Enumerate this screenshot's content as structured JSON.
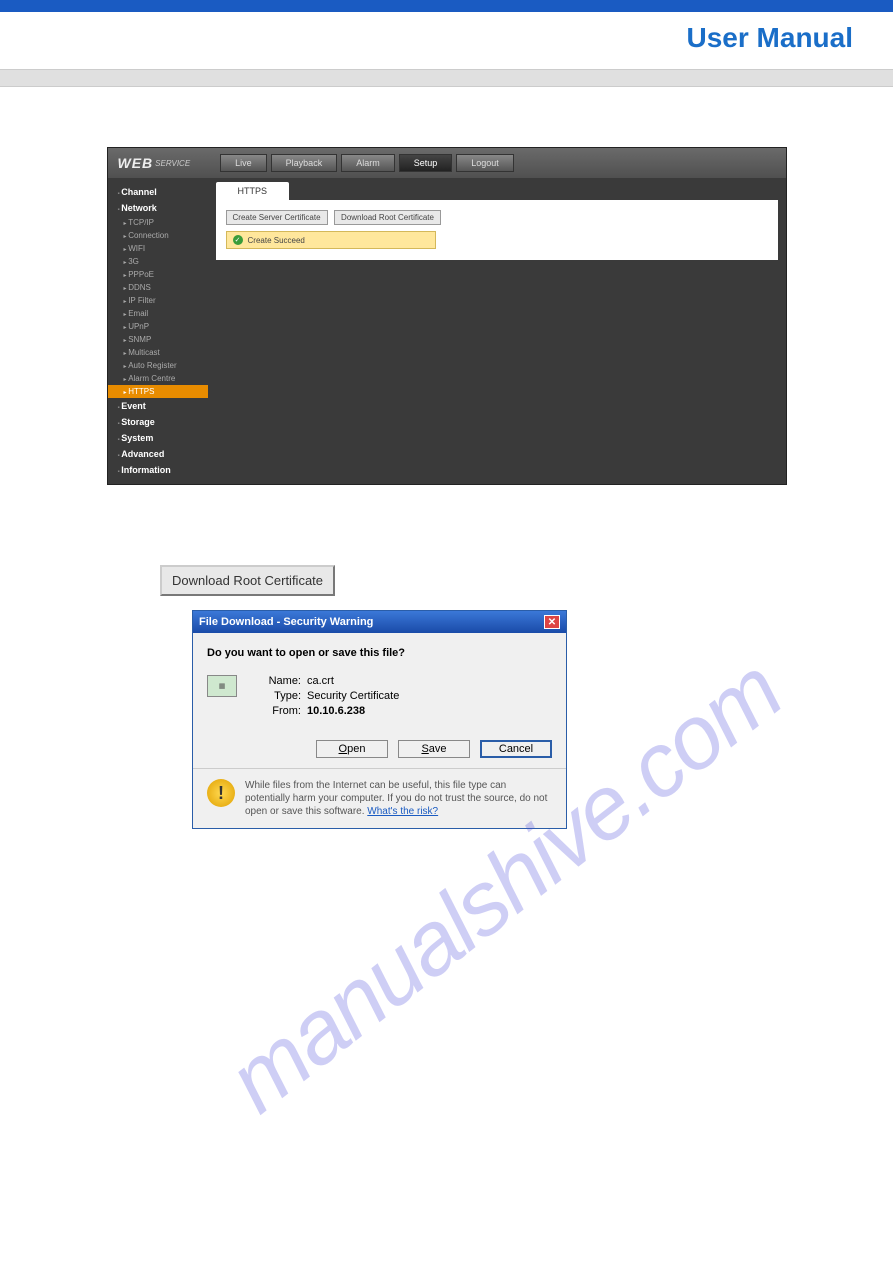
{
  "header": {
    "title": "User Manual"
  },
  "app": {
    "logo_main": "WEB",
    "logo_sub": "SERVICE",
    "nav": [
      "Live",
      "Playback",
      "Alarm",
      "Setup",
      "Logout"
    ],
    "nav_active": "Setup",
    "sidebar": {
      "sections_top": [
        "Channel",
        "Network"
      ],
      "network_items": [
        "TCP/IP",
        "Connection",
        "WIFI",
        "3G",
        "PPPoE",
        "DDNS",
        "IP Filter",
        "Email",
        "UPnP",
        "SNMP",
        "Multicast",
        "Auto Register",
        "Alarm Centre",
        "HTTPS"
      ],
      "network_active": "HTTPS",
      "sections_bottom": [
        "Event",
        "Storage",
        "System",
        "Advanced",
        "Information"
      ]
    },
    "panel": {
      "tab": "HTTPS",
      "btn_create": "Create Server Certificate",
      "btn_download": "Download Root Certificate",
      "success": "Create Succeed"
    }
  },
  "download_btn": "Download Root Certificate",
  "dialog": {
    "title": "File Download - Security Warning",
    "question": "Do you want to open or save this file?",
    "name_label": "Name:",
    "name_value": "ca.crt",
    "type_label": "Type:",
    "type_value": "Security Certificate",
    "from_label": "From:",
    "from_value": "10.10.6.238",
    "open_pre": "O",
    "open_rest": "pen",
    "save_pre": "S",
    "save_rest": "ave",
    "cancel": "Cancel",
    "warning_text": "While files from the Internet can be useful, this file type can potentially harm your computer. If you do not trust the source, do not open or save this software. ",
    "warning_link": "What's the risk?"
  },
  "watermark": "manualshive.com"
}
